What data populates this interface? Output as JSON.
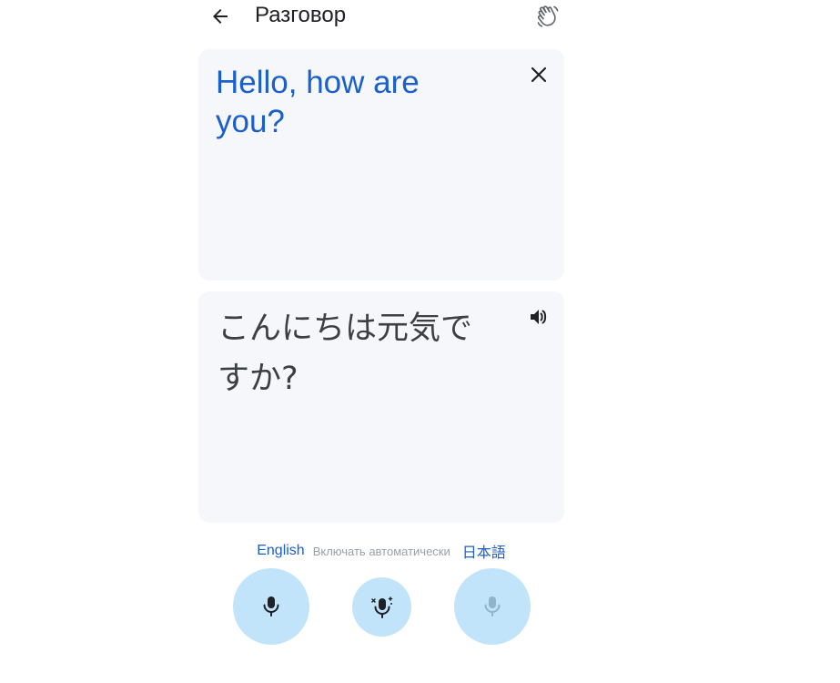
{
  "header": {
    "title": "Разговор",
    "back_icon": "arrow-back-icon",
    "action_icon": "waving-hand-icon"
  },
  "source_card": {
    "text": "Hello, how are you?",
    "close_icon": "close-icon"
  },
  "target_card": {
    "text": "こんにちは元気ですか?",
    "speaker_icon": "volume-up-icon"
  },
  "languages": {
    "left": "English",
    "auto": "Включать автоматически",
    "right": "日本語"
  },
  "colors": {
    "accent": "#1a5fcb",
    "card_bg": "#f6f7fb",
    "mic_bg": "#c2e4fa",
    "muted_text": "#9aa0a6"
  },
  "mic_buttons": {
    "left_icon": "mic-icon",
    "auto_icon": "auto-mic-icon",
    "right_icon": "mic-icon"
  }
}
